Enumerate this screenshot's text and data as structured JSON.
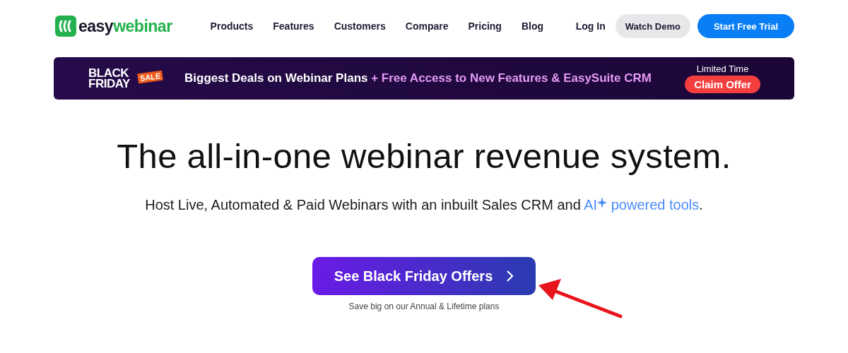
{
  "header": {
    "logo": {
      "dark": "easy",
      "accent": "webinar"
    },
    "nav": [
      "Products",
      "Features",
      "Customers",
      "Compare",
      "Pricing",
      "Blog"
    ],
    "login": "Log In",
    "demo_button": "Watch Demo",
    "trial_button": "Start Free Trial"
  },
  "banner": {
    "badge": {
      "line_1": "BLACK",
      "line_2": "FRIDAY",
      "tag": "SALE"
    },
    "headline": [
      {
        "kind": "plain",
        "text": "Biggest Deals on Webinar Plans "
      },
      {
        "kind": "accent",
        "text": "+ Free Access to New Features & EasySuite CRM"
      }
    ],
    "limited": "Limited Time",
    "claim_button": "Claim Offer"
  },
  "hero": {
    "title": "The all-in-one webinar revenue system.",
    "subtitle": [
      {
        "kind": "plain",
        "text": "Host Live, Automated & Paid Webinars with an inbuilt Sales CRM and "
      },
      {
        "kind": "accent",
        "text": "AI"
      },
      {
        "kind": "sparkle"
      },
      {
        "kind": "accent",
        "text": " powered tools"
      },
      {
        "kind": "plain",
        "text": "."
      }
    ],
    "cta": "See Black Friday Offers",
    "note": "Save big on our Annual & Lifetime plans"
  }
}
